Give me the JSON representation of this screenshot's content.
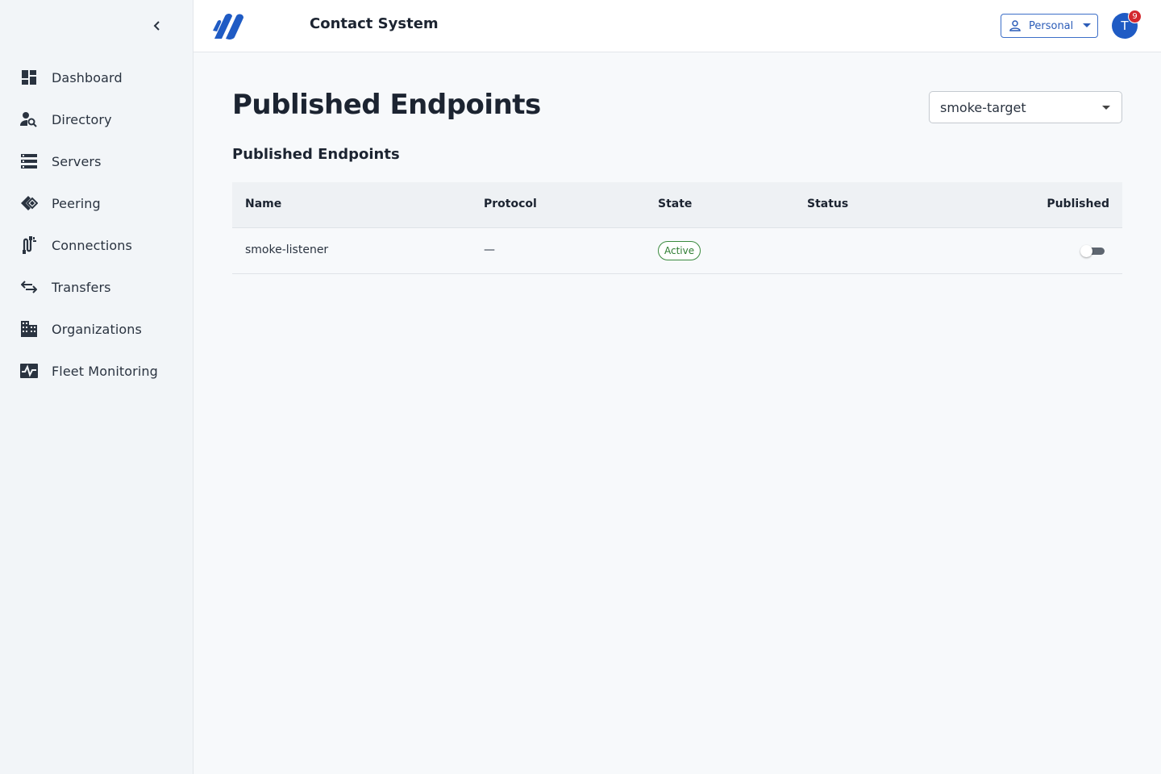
{
  "app": {
    "title": "Contact System"
  },
  "sidebar": {
    "items": [
      {
        "label": "Dashboard",
        "icon": "dashboard-icon"
      },
      {
        "label": "Directory",
        "icon": "person-search-icon"
      },
      {
        "label": "Servers",
        "icon": "servers-icon"
      },
      {
        "label": "Peering",
        "icon": "peering-icon"
      },
      {
        "label": "Connections",
        "icon": "connections-icon"
      },
      {
        "label": "Transfers",
        "icon": "transfers-icon"
      },
      {
        "label": "Organizations",
        "icon": "buildings-icon"
      },
      {
        "label": "Fleet Monitoring",
        "icon": "monitoring-icon"
      }
    ]
  },
  "header": {
    "persona_label": "Personal",
    "avatar_initial": "T",
    "notification_count": "9"
  },
  "main": {
    "page_title": "Published Endpoints",
    "target_select": {
      "value": "smoke-target"
    },
    "section_title": "Published Endpoints",
    "table": {
      "columns": [
        "Name",
        "Protocol",
        "State",
        "Status",
        "Published"
      ],
      "rows": [
        {
          "name": "smoke-listener",
          "protocol": "—",
          "state": "Active",
          "status": "",
          "published": false
        }
      ]
    }
  },
  "colors": {
    "accent": "#1f5bc4",
    "badge_border": "#3a8a3e",
    "notification": "#d3272e"
  }
}
